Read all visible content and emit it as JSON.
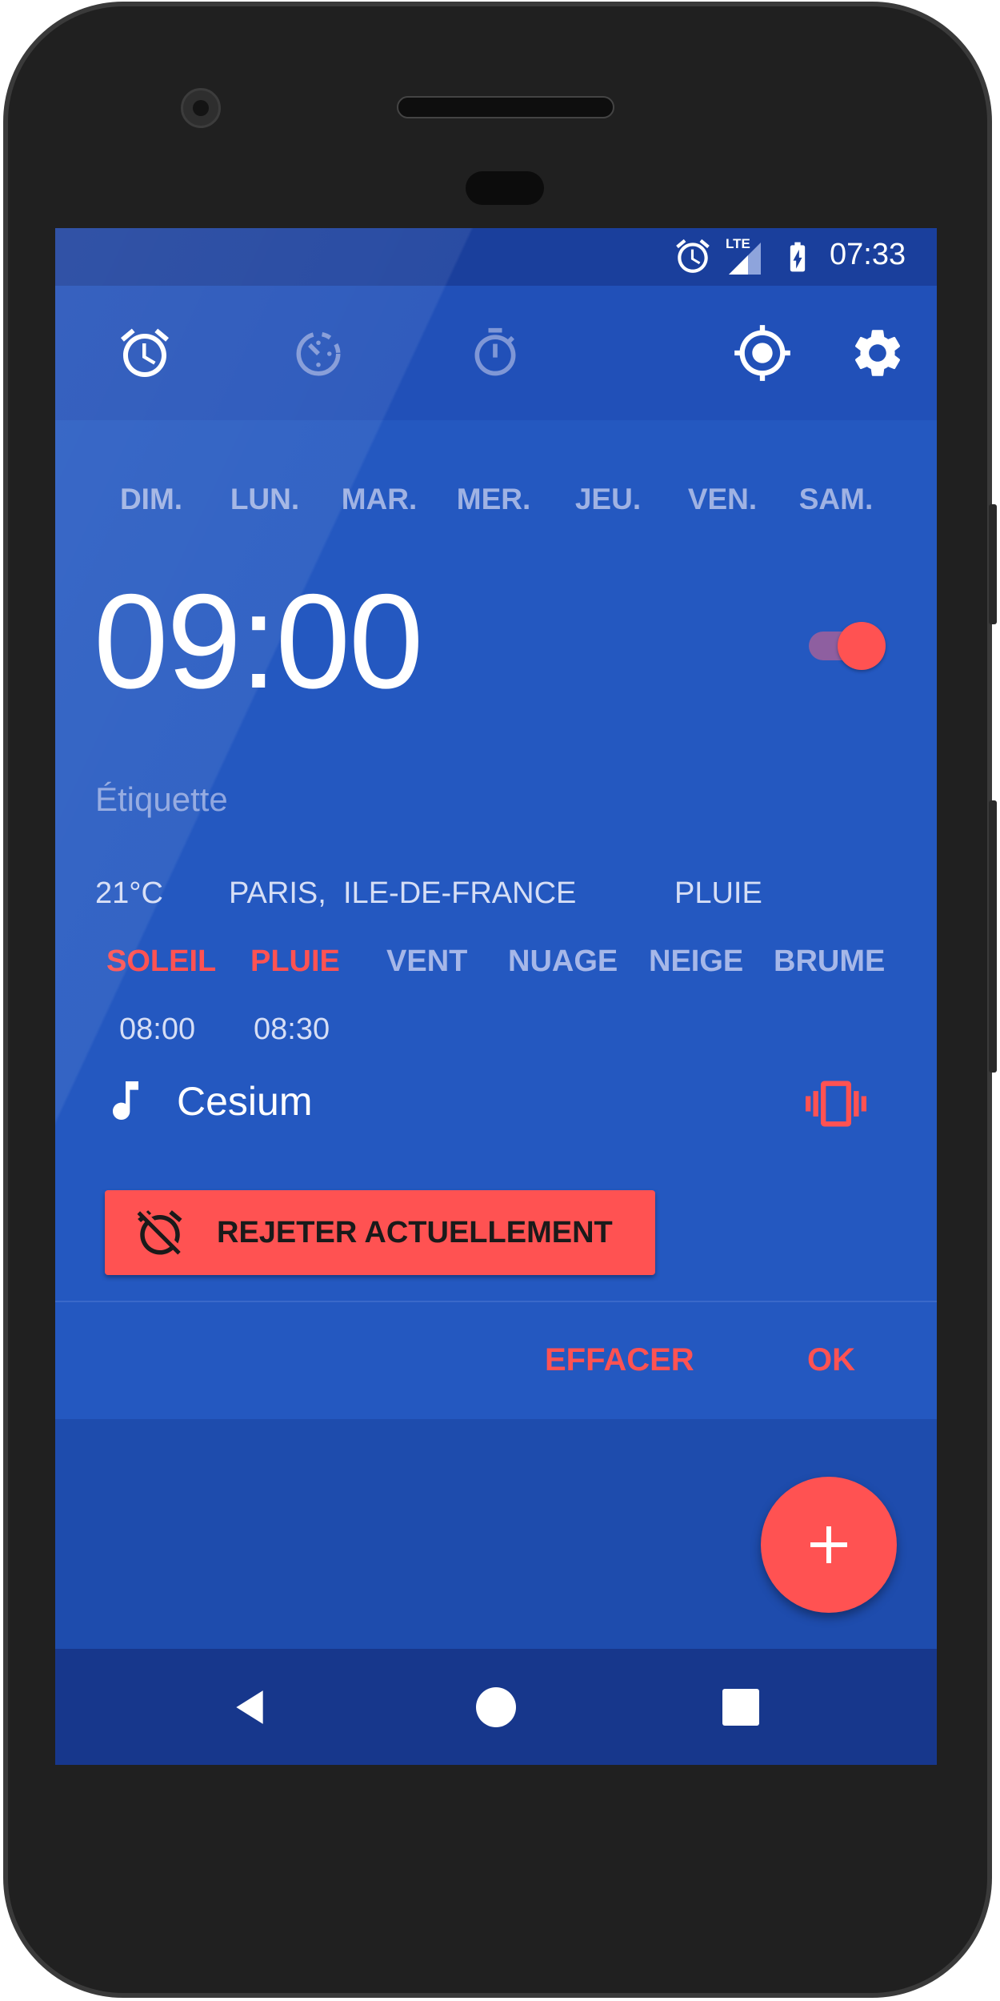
{
  "status_bar": {
    "time": "07:33",
    "network": "LTE",
    "icons": [
      "alarm-icon",
      "lte-signal-icon",
      "battery-charging-icon"
    ]
  },
  "tabs": [
    {
      "name": "alarm",
      "icon": "alarm-clock-icon",
      "active": true
    },
    {
      "name": "clock",
      "icon": "clock-face-icon",
      "active": false
    },
    {
      "name": "timer",
      "icon": "stopwatch-icon",
      "active": false
    }
  ],
  "toolbar_actions": [
    {
      "icon": "location-target-icon"
    },
    {
      "icon": "gear-icon"
    }
  ],
  "alarm": {
    "days": [
      "DIM.",
      "LUN.",
      "MAR.",
      "MER.",
      "JEU.",
      "VEN.",
      "SAM."
    ],
    "time": "09:00",
    "enabled": true,
    "label_placeholder": "Étiquette",
    "temperature": "21°C",
    "location_city": "PARIS,",
    "location_region": "ILE-DE-FRANCE",
    "current_weather": "PLUIE",
    "weather_options": [
      {
        "label": "SOLEIL",
        "active": true
      },
      {
        "label": "PLUIE",
        "active": true
      },
      {
        "label": "VENT",
        "active": false
      },
      {
        "label": "NUAGE",
        "active": false
      },
      {
        "label": "NEIGE",
        "active": false
      },
      {
        "label": "BRUME",
        "active": false
      }
    ],
    "weather_times": [
      "08:00",
      "08:30"
    ],
    "ringtone": "Cesium",
    "vibrate": true,
    "dismiss_label": "REJETER ACTUELLEMENT",
    "delete_label": "EFFACER",
    "ok_label": "OK"
  },
  "fab": {
    "icon": "plus-icon"
  },
  "nav": [
    "back-icon",
    "home-icon",
    "recents-icon"
  ],
  "colors": {
    "primary": "#2458c0",
    "primary_dark": "#1a3f9c",
    "accent": "#ff5252",
    "muted_text": "#9fb2e3"
  }
}
